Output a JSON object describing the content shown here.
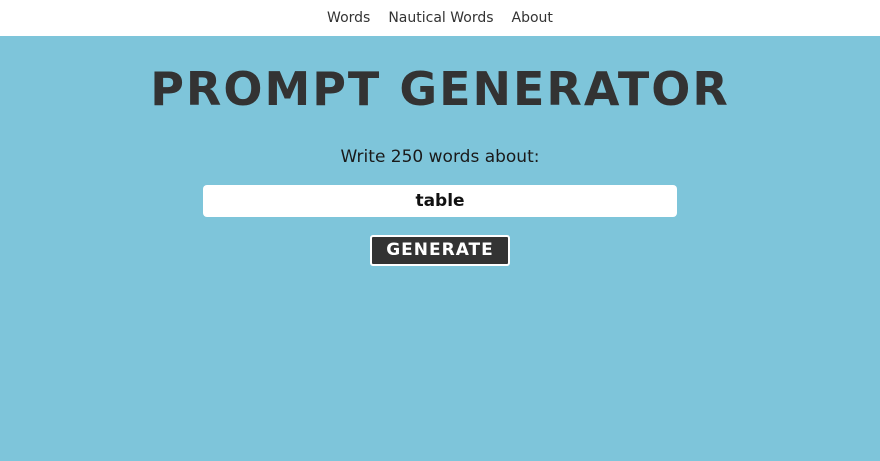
{
  "nav": {
    "items": [
      {
        "label": "Words"
      },
      {
        "label": "Nautical Words"
      },
      {
        "label": "About"
      }
    ]
  },
  "main": {
    "title": "PROMPT GENERATOR",
    "prompt_text": "Write 250 words about:",
    "word_value": "table",
    "generate_label": "GENERATE"
  },
  "colors": {
    "background": "#7ec5da",
    "nav_background": "#ffffff",
    "title": "#333333",
    "button": "#333333"
  }
}
